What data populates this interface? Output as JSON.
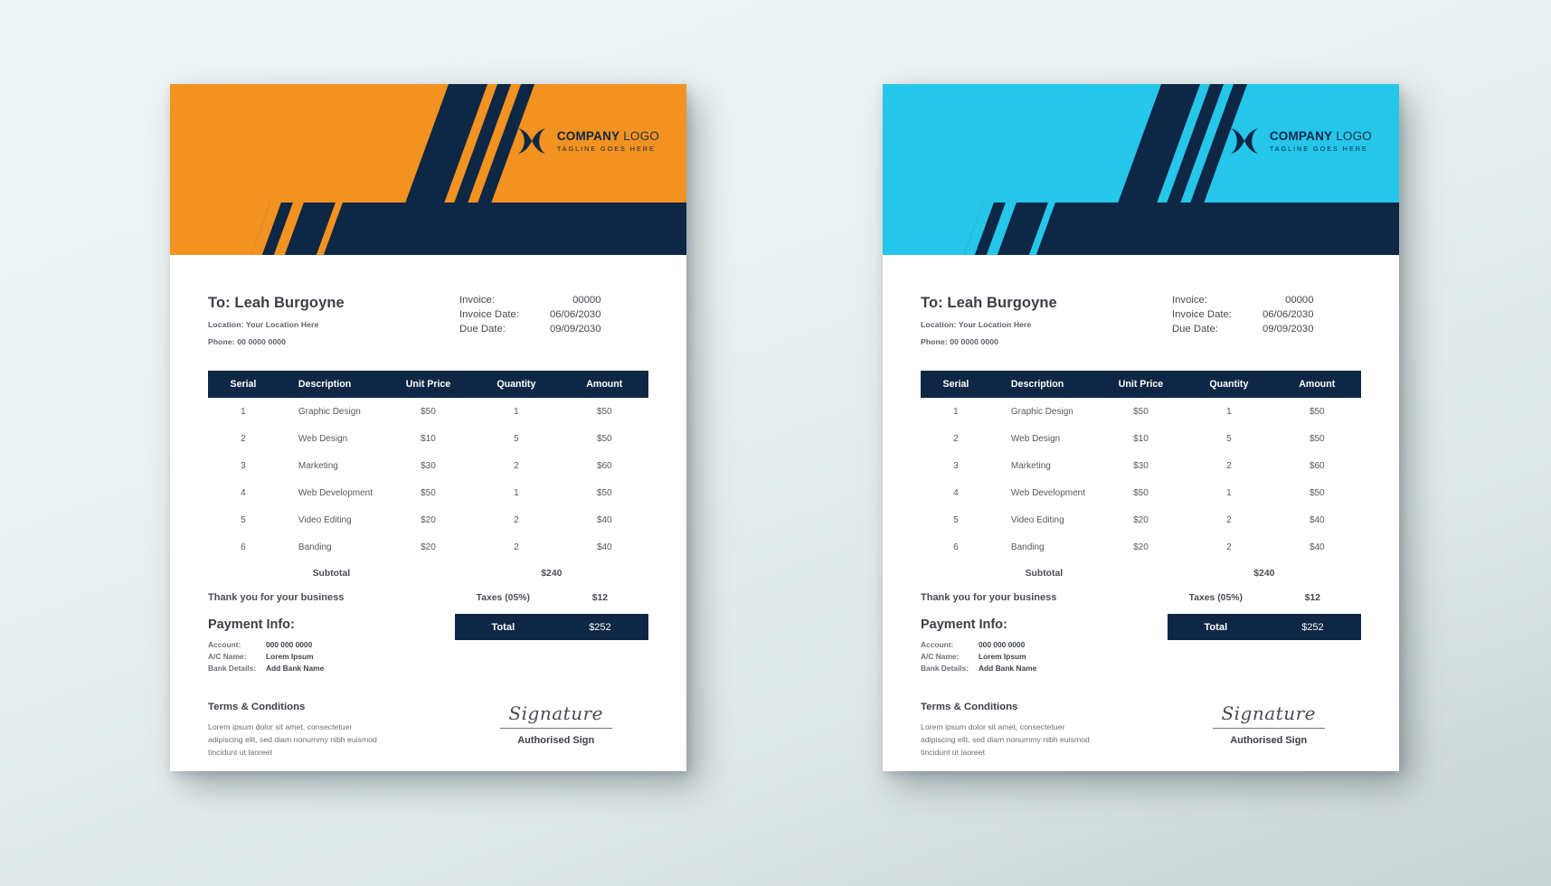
{
  "colors": {
    "navy": "#0D2744",
    "orange": "#F29220",
    "cyan": "#25C6EA",
    "sheet": "#FFFFFF",
    "background": "#EAF2F2"
  },
  "logo": {
    "mark": "bowtie-logo-icon",
    "name_bold": "COMPANY",
    "name_light": "LOGO",
    "tagline": "TAGLINE GOES HERE"
  },
  "bill_to": {
    "name": "To: Leah Burgoyne",
    "location": "Location: Your Location Here",
    "phone": "Phone: 00 0000 0000"
  },
  "invoice_meta": [
    {
      "label": "Invoice:",
      "value": "00000"
    },
    {
      "label": "Invoice Date:",
      "value": "06/06/2030"
    },
    {
      "label": "Due Date:",
      "value": "09/09/2030"
    }
  ],
  "table": {
    "headers": [
      "Serial",
      "Description",
      "Unit Price",
      "Quantity",
      "Amount"
    ],
    "rows": [
      [
        "1",
        "Graphic Design",
        "$50",
        "1",
        "$50"
      ],
      [
        "2",
        "Web Design",
        "$10",
        "5",
        "$50"
      ],
      [
        "3",
        "Marketing",
        "$30",
        "2",
        "$60"
      ],
      [
        "4",
        "Web Development",
        "$50",
        "1",
        "$50"
      ],
      [
        "5",
        "Video Editing",
        "$20",
        "2",
        "$40"
      ],
      [
        "6",
        "Banding",
        "$20",
        "2",
        "$40"
      ]
    ]
  },
  "summary": {
    "subtotal_label": "Subtotal",
    "subtotal_value": "$240",
    "taxes_label": "Taxes (05%)",
    "taxes_value": "$12",
    "total_label": "Total",
    "total_value": "$252"
  },
  "thanks": "Thank you for your business",
  "payment": {
    "title": "Payment Info:",
    "rows": [
      {
        "label": "Account:",
        "value": "000 000 0000"
      },
      {
        "label": "A/C Name:",
        "value": "Lorem Ipsum"
      },
      {
        "label": "Bank Details:",
        "value": "Add Bank Name"
      }
    ]
  },
  "terms": {
    "title": "Terms & Conditions",
    "body": "Lorem ipsum dolor sit amet, consectetuer adipiscing elit, sed diam nonummy nibh euismod tincidunt ut laoreet"
  },
  "signature": {
    "script": "Signature",
    "label": "Authorised Sign"
  }
}
